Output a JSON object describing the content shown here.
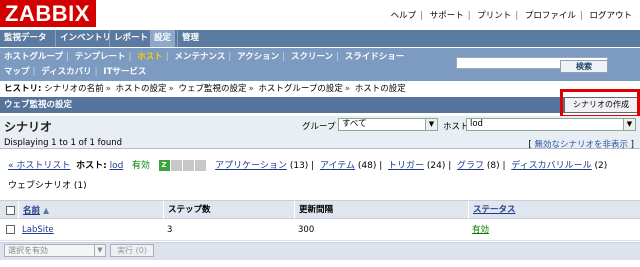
{
  "brand": {
    "logo": "ZABBIX"
  },
  "top_links": [
    "ヘルプ",
    "サポート",
    "プリント",
    "プロファイル",
    "ログアウト"
  ],
  "main_menu": [
    "監視データ",
    "インベントリ",
    "レポート",
    "設定",
    "管理"
  ],
  "main_menu_active": "設定",
  "sub_menu_row1": [
    "ホストグループ",
    "テンプレート",
    "ホスト",
    "メンテナンス",
    "アクション",
    "スクリーン",
    "スライドショー"
  ],
  "sub_menu_row1_current": "ホスト",
  "sub_menu_row2": [
    "マップ",
    "ディスカバリ",
    "ITサービス"
  ],
  "search": {
    "button": "検索",
    "value": ""
  },
  "breadcrumb": {
    "label": "ヒストリ:",
    "items": [
      "シナリオの名前",
      "ホストの設定",
      "ウェブ監視の設定",
      "ホストグループの設定",
      "ホストの設定"
    ]
  },
  "section_title": "ウェブ監視の設定",
  "create_button": "シナリオの作成",
  "list": {
    "title": "シナリオ",
    "displaying": "Displaying 1 to 1 of 1 found",
    "filter_group_label": "グループ",
    "filter_group_value": "すべて",
    "filter_host_label": "ホスト",
    "filter_host_value": "lod",
    "hide_disabled": "無効なシナリオを非表示"
  },
  "host_nav": {
    "host_list": "« ホストリスト",
    "host_label": "ホスト:",
    "host_name": "lod",
    "status": "有効",
    "zbx_icon": "Z",
    "applications": "アプリケーション",
    "applications_count": "(13)",
    "items": "アイテム",
    "items_count": "(48)",
    "triggers": "トリガー",
    "triggers_count": "(24)",
    "graphs": "グラフ",
    "graphs_count": "(8)",
    "discovery": "ディスカバリルール",
    "discovery_count": "(2)",
    "web_scenario": "ウェブシナリオ",
    "web_scenario_count": "(1)"
  },
  "table": {
    "headers": [
      "名前",
      "ステップ数",
      "更新間隔",
      "ステータス"
    ],
    "rows": [
      {
        "name": "LabSite",
        "steps": "3",
        "interval": "300",
        "status": "有効"
      }
    ]
  },
  "footer": {
    "bulk_select": "選択を有効",
    "execute": "実行 (0)"
  },
  "colors": {
    "logo_bg": "#d40000",
    "menu_bg": "#5a7aa0",
    "submenu_bg": "#7d9bc1",
    "title_bg": "#56739c",
    "status_green": "#008000",
    "link_blue": "#1f3b8a",
    "highlight_red": "#e00000"
  }
}
